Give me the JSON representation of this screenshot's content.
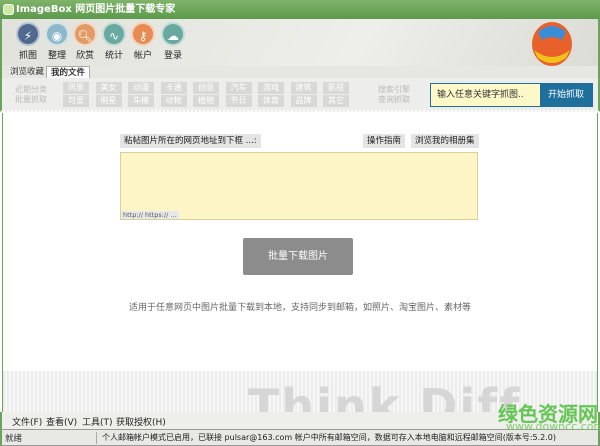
{
  "window": {
    "title": "ImageBox  网页图片批量下载专家"
  },
  "toolbar": {
    "items": [
      {
        "label": "抓图",
        "icon": "lightning-icon",
        "color": "#4f6a8e"
      },
      {
        "label": "整理",
        "icon": "eye-icon",
        "color": "#8cb9c9"
      },
      {
        "label": "欣赏",
        "icon": "magnifier-icon",
        "color": "#e39b66"
      },
      {
        "label": "统计",
        "icon": "chart-line-icon",
        "color": "#6aa99f"
      },
      {
        "label": "帐户",
        "icon": "key-icon",
        "color": "#e88b52"
      },
      {
        "label": "登录",
        "icon": "cloud-upload-icon",
        "color": "#6aa99f"
      }
    ]
  },
  "tabs": [
    {
      "label": "浏览收藏"
    },
    {
      "label": "我的文件",
      "active": true
    }
  ],
  "categories": {
    "left_label_1": "近期分类",
    "left_label_2": "批量抓取",
    "row1": [
      "风景",
      "美女",
      "动漫",
      "卡通",
      "创意",
      "汽车",
      "游戏",
      "建筑",
      "影视"
    ],
    "row2": [
      "可爱",
      "明星",
      "车模",
      "动物",
      "植物",
      "节日",
      "体育",
      "品牌",
      "其它"
    ],
    "right_label_1": "搜索引擎",
    "right_label_2": "查询抓取"
  },
  "search": {
    "placeholder": "输入任意关键字抓图..",
    "button": "开始抓取"
  },
  "main": {
    "paste_label": "粘帖图片所在的网页地址到下框 ...:",
    "guide_button": "操作指南",
    "album_button": "浏览我的相册集",
    "url_hint": "http:// https:// ...",
    "download_button": "批量下载图片",
    "description": "适用于任意网页中图片批量下载到本地，支持同步到邮箱，如照片、淘宝图片、素材等",
    "watermark": "Think Diff"
  },
  "menu": [
    "文件(F)",
    "查看(V)",
    "工具(T)",
    "获取授权(H)"
  ],
  "status": {
    "state": "就绪",
    "message": "个人邮箱帐户模式已启用，已联接 pulsar@163.com 帐户中所有邮箱空间，数据可存入本地电脑和远程邮箱空间(版本号:5.2.0)"
  },
  "site_watermark": {
    "name": "绿色资源网",
    "url": "www.downcc.com"
  },
  "colors": {
    "accent": "#1f6f9c",
    "frame": "#6aa35a",
    "input_bg": "#fdf5c5"
  }
}
